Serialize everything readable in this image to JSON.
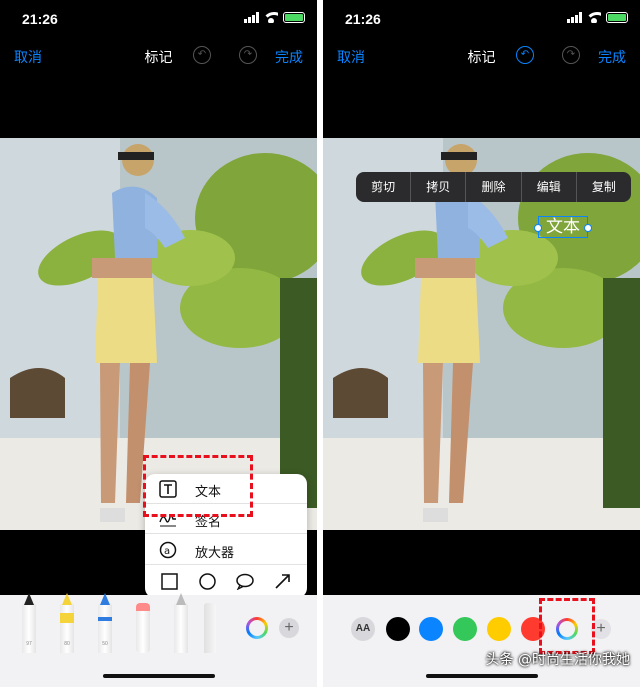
{
  "left": {
    "status": {
      "time": "21:26"
    },
    "nav": {
      "cancel": "取消",
      "title": "标记",
      "done": "完成"
    },
    "popover": {
      "items": [
        {
          "label": "文本",
          "icon": "text-box-icon"
        },
        {
          "label": "签名",
          "icon": "signature-icon"
        },
        {
          "label": "放大器",
          "icon": "magnifier-icon"
        }
      ],
      "shapes": [
        "square-icon",
        "circle-icon",
        "speech-bubble-icon",
        "arrow-icon"
      ]
    },
    "toolbar": {
      "tools": [
        {
          "name": "pen",
          "num": "97"
        },
        {
          "name": "highlighter",
          "num": "80",
          "color": "#f5d33b"
        },
        {
          "name": "pencil",
          "num": "50",
          "color": "#2f7de1"
        },
        {
          "name": "eraser",
          "num": ""
        },
        {
          "name": "lasso",
          "num": ""
        },
        {
          "name": "ruler",
          "num": ""
        }
      ]
    }
  },
  "right": {
    "status": {
      "time": "21:26"
    },
    "nav": {
      "cancel": "取消",
      "title": "标记",
      "done": "完成"
    },
    "edit_menu": [
      "剪切",
      "拷贝",
      "删除",
      "编辑",
      "复制"
    ],
    "text_annotation": "文本",
    "toolbar": {
      "aa_label": "AA",
      "colors": [
        "#000000",
        "#0a84ff",
        "#34c759",
        "#ffcc00",
        "#ff3b30"
      ]
    }
  },
  "watermark": "头条 @时尚生活你我她",
  "colors": {
    "accent": "#0a84ff",
    "highlight_dash": "#e8101c"
  }
}
